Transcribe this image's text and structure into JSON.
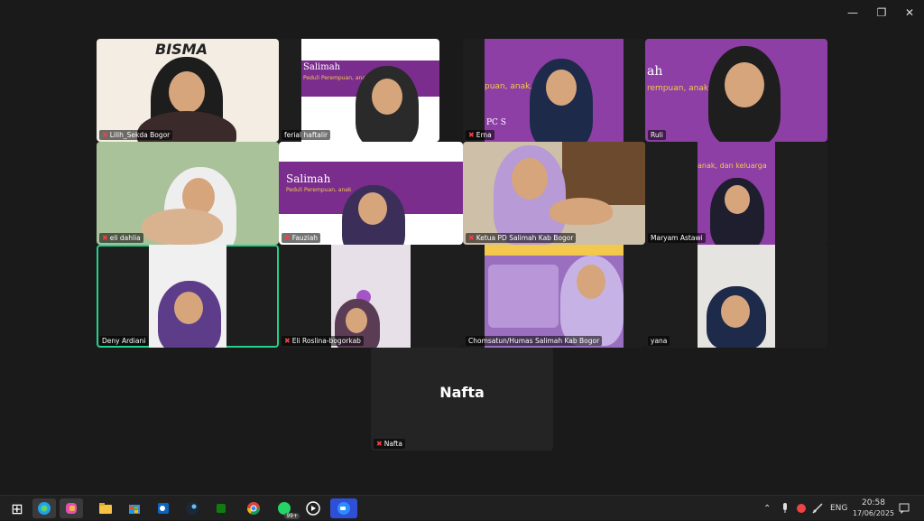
{
  "window": {
    "controls": {
      "minimize": "—",
      "restore": "❐",
      "close": "✕"
    }
  },
  "tiles": [
    {
      "name": "Lilih_Sekda Bogor",
      "banner": "BISMA",
      "muted": true
    },
    {
      "name": "ferial haftalir",
      "banner": "Salimah",
      "banner_sub": "Peduli Perempuan, anak,",
      "muted": false
    },
    {
      "name": "Erna",
      "banner": "PC S",
      "banner_sub": "puan, anak, d",
      "muted": true
    },
    {
      "name": "Ruli",
      "banner": "ah",
      "banner_sub": "rempuan, anak, dan keluarga",
      "muted": false
    },
    {
      "name": "eli dahlia",
      "muted": true
    },
    {
      "name": "Fauziah",
      "banner": "Salimah",
      "banner_sub": "Peduli Perempuan, anak",
      "muted": true
    },
    {
      "name": "Ketua PD Salimah Kab Bogor",
      "muted": true
    },
    {
      "name": "Maryam Astawi",
      "banner_sub": "anak, dan keluarga",
      "muted": false
    },
    {
      "name": "Deny Ardiani",
      "muted": false,
      "active": true
    },
    {
      "name": "Eli Roslina-bogorkab",
      "muted": true
    },
    {
      "name": "Chomsatun/Humas Salimah Kab Bogor",
      "muted": false
    },
    {
      "name": "yana",
      "muted": false
    }
  ],
  "nafta": {
    "display_name": "Nafta",
    "label": "Nafta",
    "muted": true
  },
  "taskbar": {
    "start": "⊞",
    "apps": [
      "edge-icon",
      "copilot-icon",
      "file-explorer-icon",
      "store-icon",
      "outlook-icon",
      "steam-icon",
      "xbox-icon",
      "chrome-icon",
      "whatsapp-icon",
      "media-player-icon",
      "zoom-icon"
    ],
    "whatsapp_badge": "99+",
    "tray_chevron": "⌃",
    "language": "ENG",
    "time": "20:58",
    "date": "17/06/2025"
  },
  "colors": {
    "active_speaker": "#23d18b",
    "purple": "#7b2d8e",
    "muted_mic": "#e44"
  }
}
